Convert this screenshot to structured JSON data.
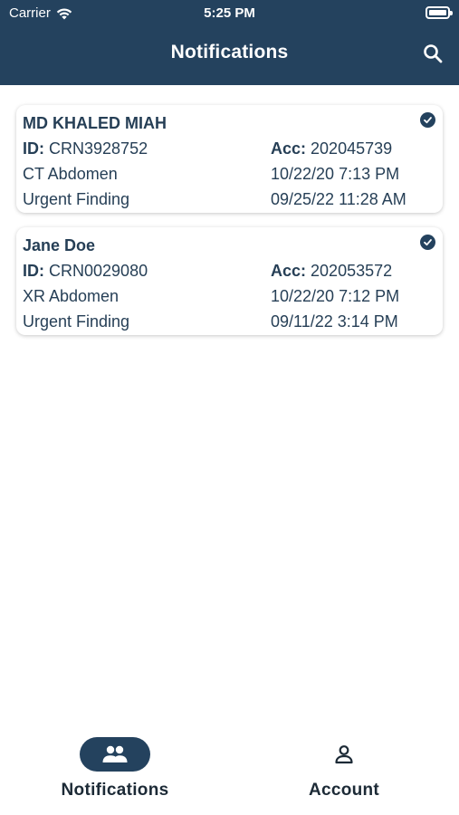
{
  "status_bar": {
    "carrier": "Carrier",
    "time": "5:25 PM"
  },
  "header": {
    "title": "Notifications",
    "search_icon": "search-icon",
    "color": "#24425e"
  },
  "notifications": [
    {
      "name": "MD KHALED MIAH",
      "id_label": "ID:",
      "id_value": "CRN3928752",
      "acc_label": "Acc:",
      "acc_value": "202045739",
      "exam": "CT Abdomen",
      "exam_datetime": "10/22/20 7:13 PM",
      "finding": "Urgent Finding",
      "finding_datetime": "09/25/22 11:28 AM",
      "status_icon": "check-circle-icon"
    },
    {
      "name": "Jane Doe",
      "id_label": "ID:",
      "id_value": "CRN0029080",
      "acc_label": "Acc:",
      "acc_value": "202053572",
      "exam": "XR Abdomen",
      "exam_datetime": "10/22/20 7:12 PM",
      "finding": "Urgent Finding",
      "finding_datetime": "09/11/22 3:14 PM",
      "status_icon": "check-circle-icon"
    }
  ],
  "tabbar": {
    "tabs": [
      {
        "label": "Notifications",
        "icon": "group-icon",
        "active": true
      },
      {
        "label": "Account",
        "icon": "person-icon",
        "active": false
      }
    ]
  }
}
